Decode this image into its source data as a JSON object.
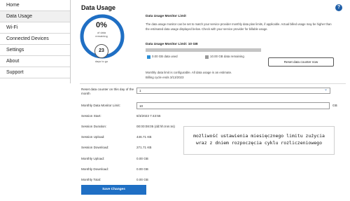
{
  "sidebar": {
    "items": [
      {
        "label": "Home",
        "active": false
      },
      {
        "label": "Data Usage",
        "active": true
      },
      {
        "label": "Wi-Fi",
        "active": false
      },
      {
        "label": "Connected Devices",
        "active": false
      },
      {
        "label": "Settings",
        "active": false
      },
      {
        "label": "About",
        "active": false
      },
      {
        "label": "Support",
        "active": false
      }
    ]
  },
  "header": {
    "title": "Data Usage",
    "help_icon": "question-mark-icon",
    "help_glyph": "?"
  },
  "gauge": {
    "percent_label": "0%",
    "sub_line1": "of data",
    "sub_line2": "remaining",
    "remaining_fraction": 1.0,
    "days": "23",
    "days_label": "days to go",
    "colors": {
      "ring": "#1f6fc4",
      "track": "#d9d9d9"
    }
  },
  "monitor": {
    "title": "Data Usage Monitor Limit",
    "description": "The data usage monitor can be set to match your service provider monthly data plan limits, if applicable. Actual billed usage may be higher than the estimated data usage displayed below. Check with your service provider for billable usage.",
    "limit_heading": "Data Usage Monitor Limit: 10 GB",
    "used_fraction": 0.0,
    "legend_used": "0.00 GB data used",
    "legend_remaining": "10.00 GB data remaining",
    "reset_button": "Reset data counter now",
    "note": "Monthly data limit is configurable. All data usage is an estimate.",
    "billing_cycle": "Billing cycle ends 3/13/2023",
    "colors": {
      "used": "#2b8fd6",
      "remaining": "#999999"
    }
  },
  "form": {
    "reset_day_label": "Reset data counter on this day of the month",
    "reset_day_value": "1",
    "limit_label": "Monthly Data Monitor Limit:",
    "limit_value": "10",
    "limit_unit": "GB",
    "rows": [
      {
        "label": "Session Start:",
        "value": "8/3/2023 7:43:56"
      },
      {
        "label": "Session Duration:",
        "value": "00:00:08:05 (dd:hh:mm:ss)"
      },
      {
        "label": "Session Upload:",
        "value": "446.71 KB"
      },
      {
        "label": "Session Download:",
        "value": "271.71 KB"
      },
      {
        "label": "Monthly Upload:",
        "value": "0.00 GB"
      },
      {
        "label": "Monthly Download:",
        "value": "0.00 GB"
      },
      {
        "label": "Monthly Total:",
        "value": "0.00 GB"
      }
    ],
    "save_button": "Save Changes"
  },
  "annotation": {
    "line1": "możliwość ustawienia miesięcznego limitu zużycia",
    "line2": "wraz z dniem rozpoczęcia cyklu rozliczeniowego"
  }
}
